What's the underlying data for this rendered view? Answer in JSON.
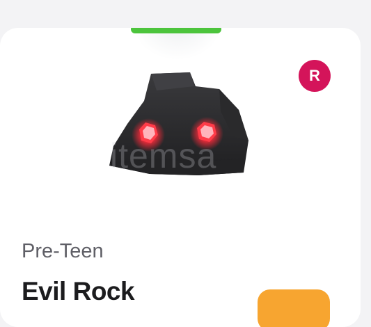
{
  "card": {
    "rarity_badge": "R",
    "watermark": "itemsa",
    "age_label": "Pre-Teen",
    "pet_name": "Evil Rock"
  },
  "colors": {
    "top_pill": "#4cc43c",
    "rarity_badge_bg": "#d4145a",
    "action_button": "#f7a530",
    "eye_glow": "#ff2a3a",
    "rock_body": "#2c2c2e"
  },
  "icons": {
    "pet_image": "evil-rock-pet-icon"
  }
}
